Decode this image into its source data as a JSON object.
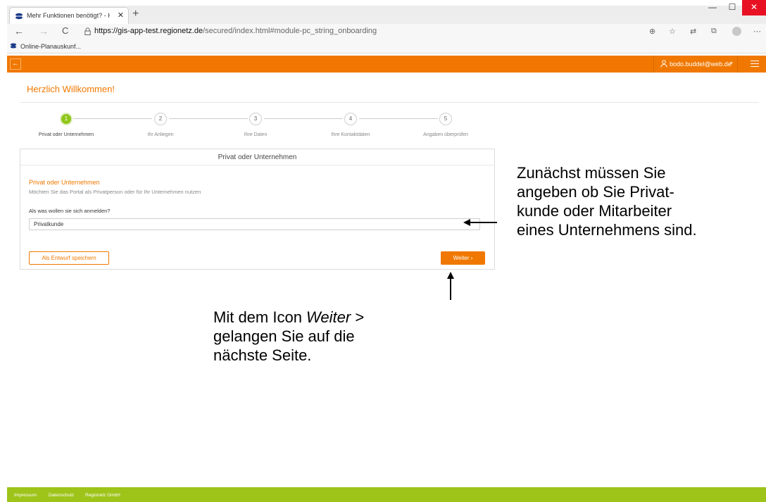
{
  "browser": {
    "tab_title": "Mehr Funktionen benötigt? - He",
    "tab_close": "✕",
    "new_tab": "+",
    "url_domain": "https://gis-app-test.regionetz.de",
    "url_path": "/secured/index.html#module-pc_string_onboarding",
    "bookmark_label": "Online-Planauskunf...",
    "window_buttons": [
      "—",
      "☐",
      "✕"
    ],
    "nav_icons": [
      "←",
      "→",
      "C"
    ],
    "toolbar_icons": [
      "⊕",
      "☆",
      "⇄",
      "⧉",
      "⋯"
    ]
  },
  "header": {
    "back_glyph": "←",
    "user_email": "bodo.buddel@web.de",
    "caret": "▾",
    "accent_color": "#f07800"
  },
  "page": {
    "title": "Herzlich Willkommen!"
  },
  "stepper": {
    "steps": [
      {
        "number": "1",
        "label": "Privat oder Unternehmen",
        "active": true
      },
      {
        "number": "2",
        "label": "Ihr Anliegen",
        "active": false
      },
      {
        "number": "3",
        "label": "Ihre Daten",
        "active": false
      },
      {
        "number": "4",
        "label": "Ihre Kontaktdaten",
        "active": false
      },
      {
        "number": "5",
        "label": "Angaben überprüfen",
        "active": false
      }
    ],
    "active_color": "#8fc71a"
  },
  "form": {
    "card_title": "Privat oder Unternehmen",
    "section_title": "Privat oder Unternehmen",
    "section_description": "Möchten Sie das Portal als Privatperson oder für Ihr Unternehmen nutzen",
    "field_label": "Als was wollen sie sich anmelden?",
    "field_value": "Privatkunde",
    "draft_button": "Als Entwurf speichern",
    "next_button": "Weiter  ›"
  },
  "footer": {
    "links": [
      "Impressum",
      "Datenschutz",
      "Regionetz GmbH"
    ],
    "color": "#9ec41a"
  },
  "annotations": {
    "callout_right_lines": [
      "Zunächst müssen Sie",
      "angeben ob Sie Privat-",
      "kunde oder Mitarbeiter",
      "eines Unternehmens sind."
    ],
    "callout_bottom_prefix": "Mit dem Icon ",
    "callout_bottom_italic": "Weiter",
    "callout_bottom_suffix": " >",
    "callout_bottom_lines": [
      "gelangen Sie auf die",
      "nächste Seite."
    ]
  }
}
